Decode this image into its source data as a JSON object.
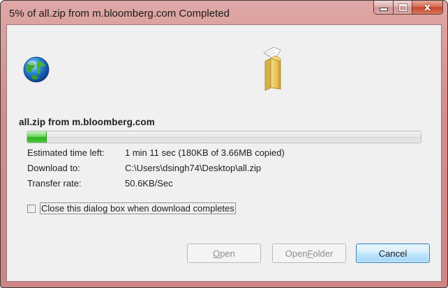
{
  "window": {
    "title": "5% of all.zip from m.bloomberg.com Completed",
    "accent_color": "#d38f8c"
  },
  "caption_buttons": {
    "minimize_icon": "minimize-icon",
    "maximize_icon": "maximize-icon",
    "close_glyph": "x"
  },
  "icons": {
    "globe": "globe-icon",
    "folder": "folder-with-paper-icon"
  },
  "download": {
    "file_label": "all.zip from m.bloomberg.com",
    "progress_percent": 5,
    "progress_color": "#3cbb2a"
  },
  "details": {
    "time_left_label": "Estimated time left:",
    "time_left_value": "1 min 11 sec (180KB of 3.66MB copied)",
    "download_to_label": "Download to:",
    "download_to_value": "C:\\Users\\dsingh74\\Desktop\\all.zip",
    "rate_label": "Transfer rate:",
    "rate_value": "50.6KB/Sec"
  },
  "options": {
    "close_when_done_label": "Close this dialog box when download completes",
    "close_when_done_checked": false
  },
  "buttons": {
    "open_prefix": "",
    "open_accel": "O",
    "open_rest": "pen",
    "open_folder_prefix": "Open ",
    "open_folder_accel": "F",
    "open_folder_rest": "older",
    "cancel_label": "Cancel"
  }
}
